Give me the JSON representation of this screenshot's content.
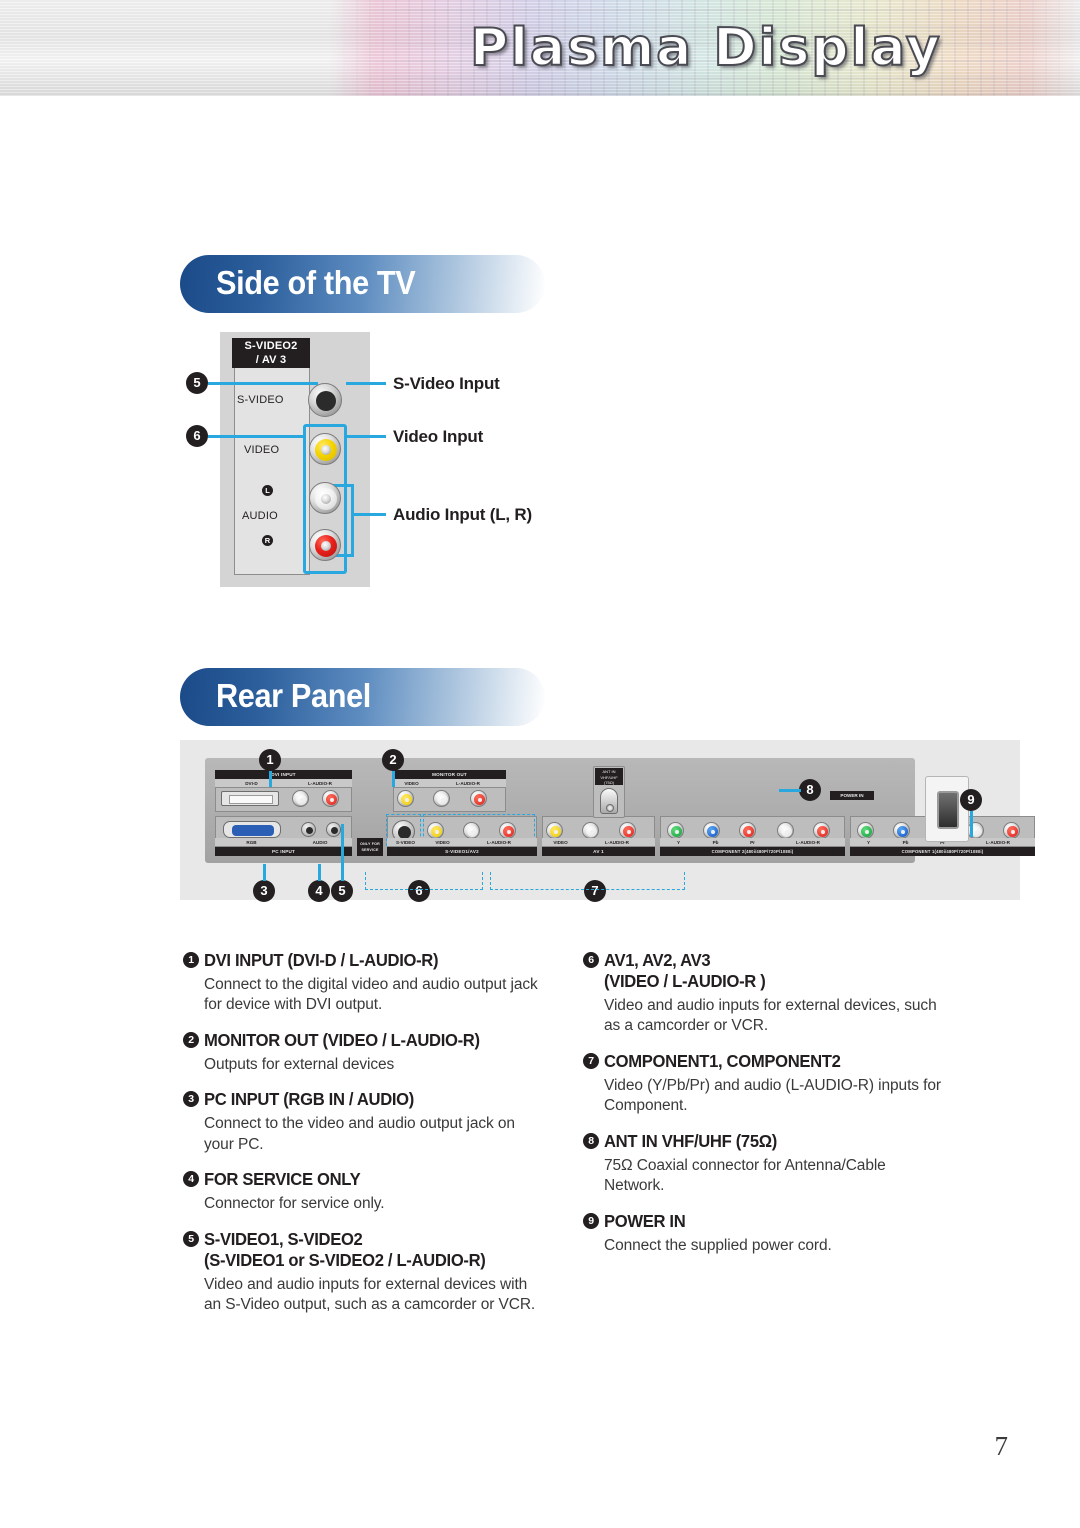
{
  "banner": {
    "title": "Plasma Display"
  },
  "sections": {
    "side": {
      "heading": "Side of the TV"
    },
    "rear": {
      "heading": "Rear Panel"
    }
  },
  "side_panel": {
    "tag_line1": "S-VIDEO2",
    "tag_line2": "/ AV 3",
    "labels": {
      "svideo": "S-VIDEO",
      "video": "VIDEO",
      "audio": "AUDIO",
      "left": "L",
      "right": "R"
    },
    "callouts": [
      {
        "num": "5",
        "label": "S-Video Input"
      },
      {
        "num": "6",
        "label": "Video Input"
      },
      {
        "num": "",
        "label": "Audio Input (L, R)"
      }
    ]
  },
  "rear_panel": {
    "numbers": [
      "1",
      "2",
      "3",
      "4",
      "5",
      "6",
      "7",
      "8",
      "9"
    ],
    "groups": {
      "dvi_input": {
        "header": "DVI INPUT",
        "sub_left": "DVI-D",
        "sub_right": "L-AUDIO-R"
      },
      "monitor_out": {
        "header": "MONITOR OUT",
        "sub_left": "VIDEO",
        "sub_right": "L-AUDIO-R"
      },
      "pc_input": {
        "header": "PC INPUT",
        "sub_left": "RGB",
        "sub_right": "AUDIO"
      },
      "service": {
        "header": "ONLY FOR SERVICE"
      },
      "svideo1_av2": {
        "header": "S-VIDEO1/AV2",
        "sub_a": "S-VIDEO",
        "sub_b": "VIDEO",
        "sub_c": "L-AUDIO-R"
      },
      "av1": {
        "header": "AV 1",
        "sub_a": "VIDEO",
        "sub_b": "L-AUDIO-R"
      },
      "component2": {
        "header": "COMPONENT 2(480i/480P/720P/1080i)",
        "sub_y": "Y",
        "sub_pb": "Pb",
        "sub_pr": "Pr",
        "sub_audio": "L-AUDIO-R"
      },
      "component1": {
        "header": "COMPONENT 1(480i/480P/720P/1080i)",
        "sub_y": "Y",
        "sub_pb": "Pb",
        "sub_pr": "Pr",
        "sub_audio": "L-AUDIO-R"
      },
      "ant_in": {
        "line1": "ANT IN",
        "line2": "VHF/UHF",
        "line3": "(75Ω)"
      },
      "power_in": {
        "label": "POWER IN"
      }
    }
  },
  "descriptions_left": [
    {
      "num": "1",
      "head": "DVI INPUT (DVI-D / L-AUDIO-R)",
      "sub": "",
      "body": "Connect to the digital video and audio output jack for device with DVI output."
    },
    {
      "num": "2",
      "head": "MONITOR OUT (VIDEO / L-AUDIO-R)",
      "sub": "",
      "body": "Outputs for external devices"
    },
    {
      "num": "3",
      "head": "PC INPUT (RGB IN / AUDIO)",
      "sub": "",
      "body": "Connect to the video and audio output jack on your PC."
    },
    {
      "num": "4",
      "head": "FOR SERVICE ONLY",
      "sub": "",
      "body": "Connector for service only."
    },
    {
      "num": "5",
      "head": "S-VIDEO1, S-VIDEO2",
      "sub": "(S-VIDEO1 or S-VIDEO2 / L-AUDIO-R)",
      "body": "Video and audio inputs for external devices with an S-Video output, such as a camcorder or VCR."
    }
  ],
  "descriptions_right": [
    {
      "num": "6",
      "head": "AV1, AV2, AV3",
      "sub": "(VIDEO / L-AUDIO-R )",
      "body": "Video and audio inputs for external devices, such as a camcorder or VCR."
    },
    {
      "num": "7",
      "head": "COMPONENT1, COMPONENT2",
      "sub": "",
      "body": "Video (Y/Pb/Pr) and audio (L-AUDIO-R) inputs for Component."
    },
    {
      "num": "8",
      "head": "ANT IN VHF/UHF (75Ω)",
      "sub": "",
      "body": "75Ω Coaxial connector for Antenna/Cable Network."
    },
    {
      "num": "9",
      "head": "POWER IN",
      "sub": "",
      "body": "Connect the supplied power cord."
    }
  ],
  "footer": {
    "page_number": "7"
  },
  "colors": {
    "accent_blue": "#29a8e0",
    "heading_blue": "#1b4a88",
    "ink": "#231f20"
  }
}
